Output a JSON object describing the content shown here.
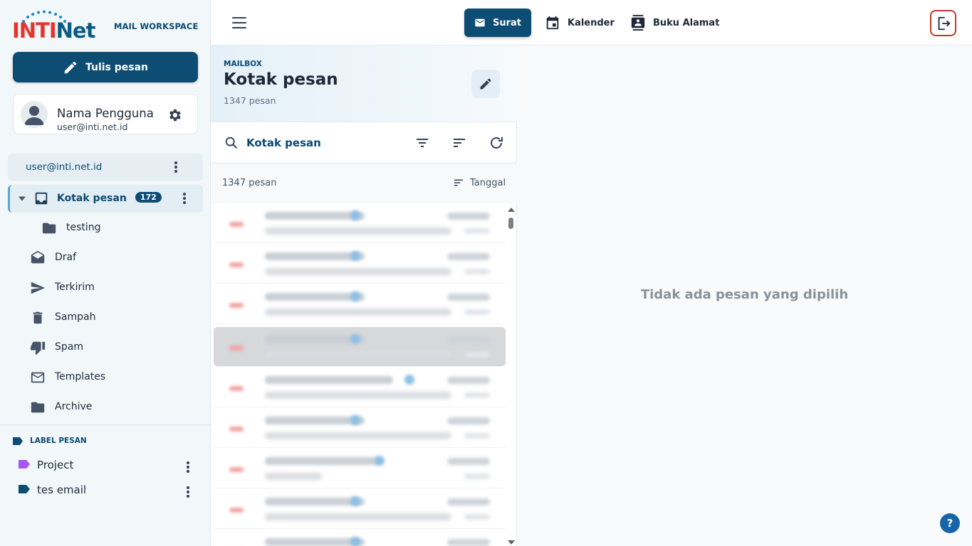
{
  "brand": {
    "logo_prefix": "INTI",
    "logo_suffix": "Net",
    "workspace_label": "MAIL WORKSPACE"
  },
  "sidebar": {
    "compose_label": "Tulis pesan",
    "user": {
      "name": "Nama Pengguna",
      "email": "user@inti.net.id"
    },
    "account": "user@inti.net.id",
    "folders": [
      {
        "label": "Kotak pesan",
        "badge": "172",
        "icon": "inbox-icon"
      },
      {
        "label": "testing",
        "icon": "folder-icon"
      },
      {
        "label": "Draf",
        "icon": "drafts-icon"
      },
      {
        "label": "Terkirim",
        "icon": "send-icon"
      },
      {
        "label": "Sampah",
        "icon": "trash-icon"
      },
      {
        "label": "Spam",
        "icon": "thumbs-down-icon"
      },
      {
        "label": "Templates",
        "icon": "mail-icon"
      },
      {
        "label": "Archive",
        "icon": "folder-icon"
      }
    ],
    "labels_heading": "LABEL PESAN",
    "labels": [
      {
        "name": "Project",
        "color": "#a855f7"
      },
      {
        "name": "tes email",
        "color": "#0e4d73"
      }
    ]
  },
  "topbar": {
    "tabs": [
      {
        "label": "Surat",
        "icon": "mail-icon"
      },
      {
        "label": "Kalender",
        "icon": "calendar-icon"
      },
      {
        "label": "Buku Alamat",
        "icon": "contacts-icon"
      }
    ]
  },
  "list": {
    "small_label": "MAILBOX",
    "title": "Kotak pesan",
    "count": "1347 pesan",
    "search_placeholder": "Kotak pesan",
    "count_row": "1347 pesan",
    "sort_label": "Tanggal"
  },
  "reading": {
    "empty_text": "Tidak ada pesan yang dipilih",
    "help_label": "?"
  },
  "colors": {
    "primary": "#0e4d73",
    "logo_blue": "#0a5a86",
    "logo_red": "#e8332a",
    "logout_border": "#c0392b"
  }
}
